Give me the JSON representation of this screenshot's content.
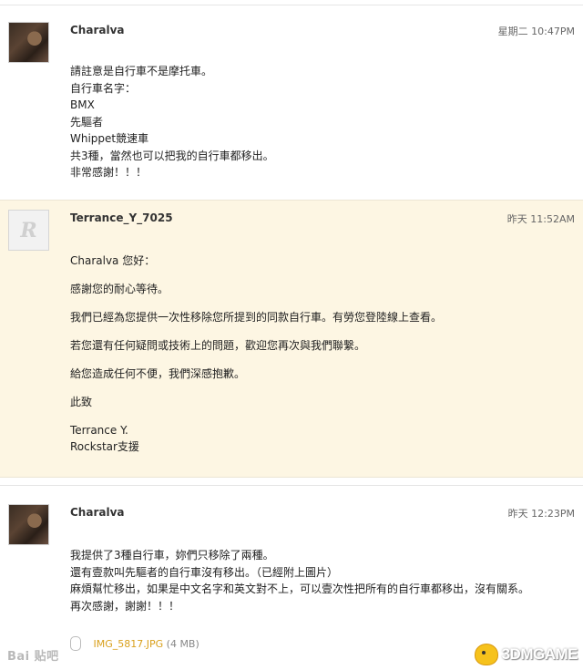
{
  "messages": [
    {
      "author": "Charalva",
      "time": "星期二 10:47PM",
      "lines": [
        "請註意是自行車不是摩托車。",
        "自行車名字：",
        "BMX",
        "先驅者",
        "Whippet競速車",
        "共3種，當然也可以把我的自行車都移出。",
        "非常感謝！！！"
      ]
    },
    {
      "author": "Terrance_Y_7025",
      "time": "昨天 11:52AM",
      "avatar_letter": "R",
      "lines": [
        "Charalva 您好：",
        "感謝您的耐心等待。",
        "我們已經為您提供一次性移除您所提到的同款自行車。有勞您登陸線上查看。",
        "若您還有任何疑問或技術上的問題，歡迎您再次與我們聯繫。",
        "給您造成任何不便，我們深感抱歉。",
        "此致",
        "Terrance Y.",
        "Rockstar支援"
      ]
    },
    {
      "author": "Charalva",
      "time": "昨天 12:23PM",
      "lines": [
        "我提供了3種自行車，妳們只移除了兩種。",
        "還有壹款叫先驅者的自行車沒有移出。（已經附上圖片）",
        "麻煩幫忙移出，如果是中文名字和英文對不上，可以壹次性把所有的自行車都移出，沒有關系。",
        "再次感謝，謝謝！！！"
      ],
      "attachment": {
        "filename": "IMG_5817.JPG",
        "size": "(4 MB)"
      }
    }
  ],
  "watermarks": {
    "left": "Bai 贴吧",
    "right": "3DMGAME"
  }
}
